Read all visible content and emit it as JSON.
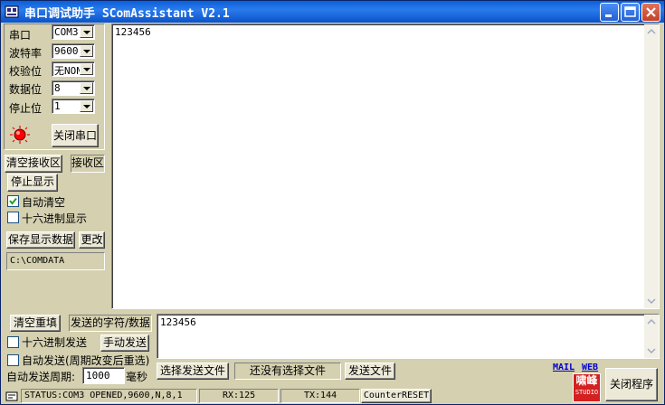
{
  "window": {
    "title": "串口调试助手  SComAssistant V2.1"
  },
  "serial": {
    "port_label": "串口",
    "port_value": "COM3",
    "baud_label": "波特率",
    "baud_value": "9600",
    "parity_label": "校验位",
    "parity_value": "无NONE",
    "data_bits_label": "数据位",
    "data_bits_value": "8",
    "stop_bits_label": "停止位",
    "stop_bits_value": "1",
    "close_port_button": "关闭串口",
    "indicator_color": "#ff0000"
  },
  "receive": {
    "clear_button": "清空接收区",
    "area_label": "接收区",
    "stop_display_button": "停止显示",
    "auto_clear_label": "自动清空",
    "auto_clear_checked": true,
    "hex_display_label": "十六进制显示",
    "hex_display_checked": false,
    "save_button": "保存显示数据",
    "change_button": "更改",
    "save_path": "C:\\COMDATA",
    "content": "123456"
  },
  "send": {
    "clear_button": "清空重填",
    "label": "发送的字符/数据",
    "content": "123456",
    "hex_send_label": "十六进制发送",
    "hex_send_checked": false,
    "manual_send_button": "手动发送",
    "auto_send_label": "自动发送(周期改变后重选)",
    "auto_send_checked": false,
    "period_label": "自动发送周期:",
    "period_value": "1000",
    "period_unit": "毫秒",
    "select_file_button": "选择发送文件",
    "file_status": "还没有选择文件",
    "send_file_button": "发送文件"
  },
  "links": {
    "mail": "MAIL",
    "web": "WEB"
  },
  "logo": {
    "line1": "啸峰",
    "line2": "STUDIO"
  },
  "exit_button": "关闭程序",
  "status": {
    "text": "STATUS:COM3 OPENED,9600,N,8,1",
    "rx": "RX:125",
    "tx": "TX:144",
    "counter_reset": "CounterRESET"
  }
}
